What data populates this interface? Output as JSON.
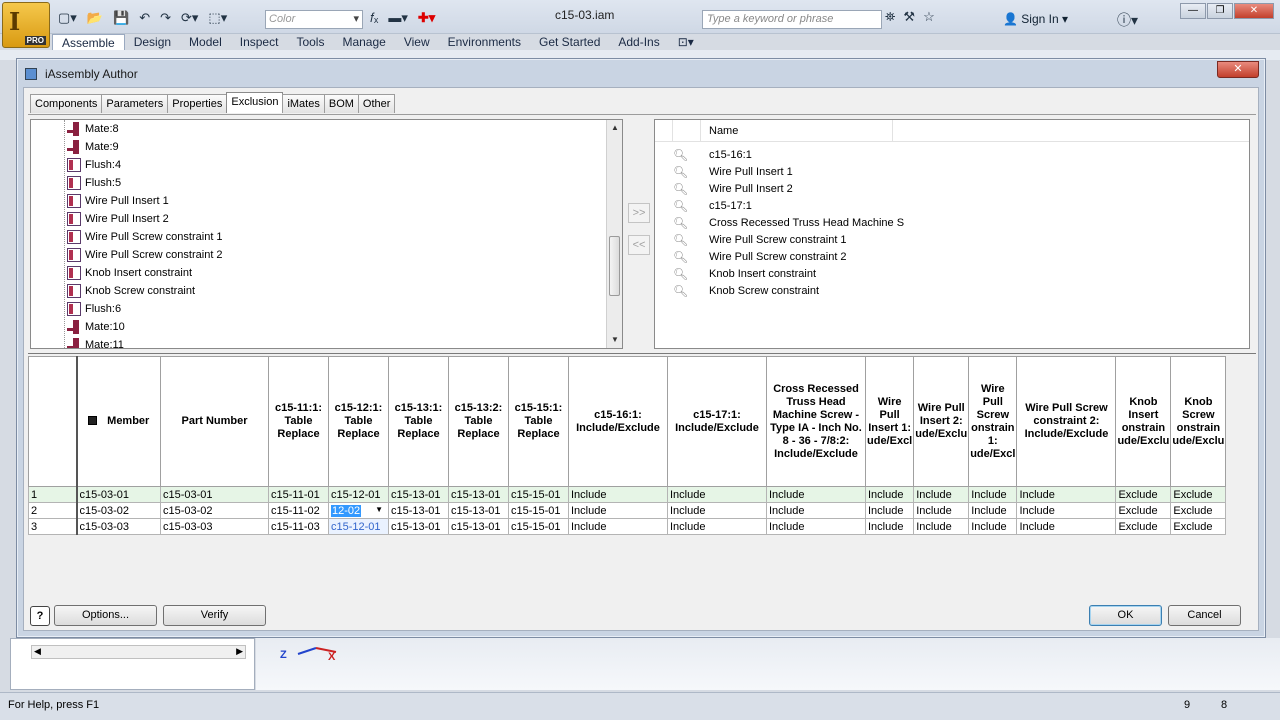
{
  "app": {
    "pro_badge": "PRO",
    "document_title": "c15-03.iam",
    "color_placeholder": "Color",
    "search_placeholder": "Type a keyword or phrase",
    "sign_in": "Sign In",
    "ribbon_tabs": [
      "Assemble",
      "Design",
      "Model",
      "Inspect",
      "Tools",
      "Manage",
      "View",
      "Environments",
      "Get Started",
      "Add-Ins"
    ]
  },
  "dialog": {
    "title": "iAssembly Author",
    "tabs": [
      "Components",
      "Parameters",
      "Properties",
      "Exclusion",
      "iMates",
      "BOM",
      "Other"
    ],
    "active_tab": "Exclusion",
    "tree_items": [
      "Mate:8",
      "Mate:9",
      "Flush:4",
      "Flush:5",
      "Wire Pull Insert 1",
      "Wire Pull Insert 2",
      "Wire Pull Screw constraint 1",
      "Wire Pull Screw constraint 2",
      "Knob Insert constraint",
      "Knob Screw constraint",
      "Flush:6",
      "Mate:10",
      "Mate:11"
    ],
    "add_button": ">>",
    "remove_button": "<<",
    "list_header": "Name",
    "list_items": [
      "c15-16:1",
      "Wire Pull Insert 1",
      "Wire Pull Insert 2",
      "c15-17:1",
      "Cross Recessed Truss Head Machine S",
      "Wire Pull Screw constraint 1",
      "Wire Pull Screw constraint 2",
      "Knob Insert constraint",
      "Knob Screw constraint"
    ],
    "table": {
      "headers": [
        "",
        "Member",
        "Part Number",
        "c15-11:1: Table Replace",
        "c15-12:1: Table Replace",
        "c15-13:1: Table Replace",
        "c15-13:2: Table Replace",
        "c15-15:1: Table Replace",
        "c15-16:1: Include/Exclude",
        "c15-17:1: Include/Exclude",
        "Cross Recessed Truss Head Machine Screw - Type IA - Inch No. 8 - 36 - 7/8:2: Include/Exclude",
        "Wire Pull Insert 1: ude/Excl",
        "Wire Pull Insert 2: ude/Exclu",
        "Wire Pull Screw onstrain 1: ude/Excl",
        "Wire Pull Screw constraint 2: Include/Exclude",
        "Knob Insert onstrain ude/Exclu",
        "Knob Screw onstrain ude/Exclu"
      ],
      "rows": [
        [
          "1",
          "c15-03-01",
          "c15-03-01",
          "c15-11-01",
          "c15-12-01",
          "c15-13-01",
          "c15-13-01",
          "c15-15-01",
          "Include",
          "Include",
          "Include",
          "Include",
          "Include",
          "Include",
          "Include",
          "Exclude",
          "Exclude"
        ],
        [
          "2",
          "c15-03-02",
          "c15-03-02",
          "c15-11-02",
          "12-02",
          "c15-13-01",
          "c15-13-01",
          "c15-15-01",
          "Include",
          "Include",
          "Include",
          "Include",
          "Include",
          "Include",
          "Include",
          "Exclude",
          "Exclude"
        ],
        [
          "3",
          "c15-03-03",
          "c15-03-03",
          "c15-11-03",
          "c15-12-01",
          "c15-13-01",
          "c15-13-01",
          "c15-15-01",
          "Include",
          "Include",
          "Include",
          "Include",
          "Include",
          "Include",
          "Include",
          "Exclude",
          "Exclude"
        ]
      ]
    },
    "buttons": {
      "help": "?",
      "options": "Options...",
      "verify": "Verify",
      "ok": "OK",
      "cancel": "Cancel"
    }
  },
  "canvas": {
    "axis_z": "Z",
    "axis_x": "X"
  },
  "status": {
    "text": "For Help, press F1",
    "num1": "9",
    "num2": "8"
  },
  "colors": {
    "accent": "#3399ff",
    "row_highlight": "#e6f5e6"
  }
}
